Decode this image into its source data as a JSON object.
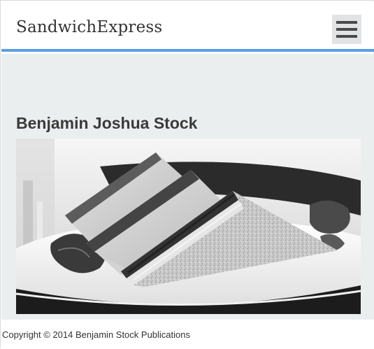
{
  "header": {
    "brand": "SandwichExpress",
    "menu_icon": "hamburger-menu-icon"
  },
  "main": {
    "title": "Benjamin Joshua Stock",
    "photo_alt": "sandwich-photo"
  },
  "footer": {
    "copyright": "Copyright © 2014 Benjamin Stock Publications"
  },
  "colors": {
    "header_accent": "#5a9ee6",
    "page_background": "#eaeeef",
    "text": "#333333"
  }
}
